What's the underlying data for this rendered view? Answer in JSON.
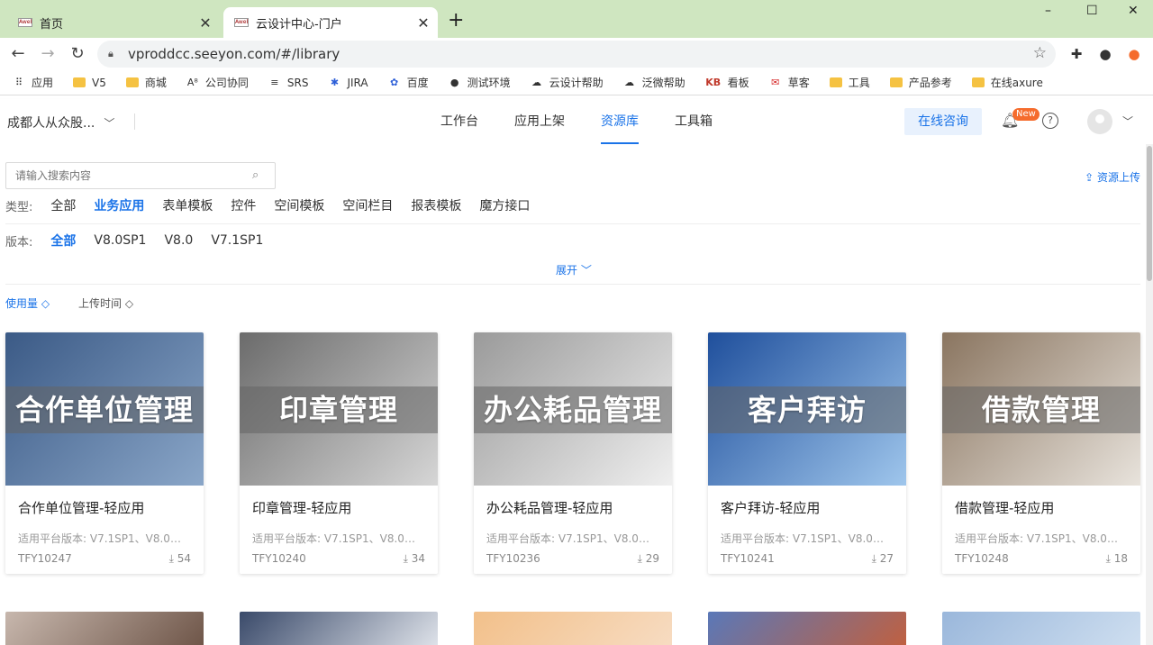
{
  "browser": {
    "tabs": [
      {
        "title": "首页",
        "favicon": "Aweb"
      },
      {
        "title": "云设计中心-门户",
        "favicon": "Aweb"
      }
    ],
    "url": "vproddcc.seeyon.com/#/library",
    "window_controls": {
      "minimize": "–",
      "maximize": "☐",
      "close": "✕"
    },
    "bookmarks": [
      {
        "label": "应用",
        "icon": "apps-grid-icon"
      },
      {
        "label": "V5",
        "icon": "folder-icon"
      },
      {
        "label": "商城",
        "icon": "folder-icon"
      },
      {
        "label": "公司协同",
        "icon": "a8-icon"
      },
      {
        "label": "SRS",
        "icon": "srs-icon"
      },
      {
        "label": "JIRA",
        "icon": "jira-icon"
      },
      {
        "label": "百度",
        "icon": "baidu-icon"
      },
      {
        "label": "测试环境",
        "icon": "globe-icon"
      },
      {
        "label": "云设计帮助",
        "icon": "cloud-icon"
      },
      {
        "label": "泛微帮助",
        "icon": "cloud-icon"
      },
      {
        "label": "看板",
        "icon": "kb-icon"
      },
      {
        "label": "草客",
        "icon": "mail-icon"
      },
      {
        "label": "工具",
        "icon": "folder-icon"
      },
      {
        "label": "产品参考",
        "icon": "folder-icon"
      },
      {
        "label": "在线axure",
        "icon": "folder-icon"
      }
    ]
  },
  "header": {
    "org": "成都人从众股...",
    "nav": [
      "工作台",
      "应用上架",
      "资源库",
      "工具箱"
    ],
    "active_nav": "资源库",
    "consult_label": "在线咨询",
    "new_badge": "New"
  },
  "search": {
    "placeholder": "请输入搜索内容"
  },
  "upload_label": "资源上传",
  "filters": {
    "type_label": "类型:",
    "types": [
      "全部",
      "业务应用",
      "表单模板",
      "控件",
      "空间模板",
      "空间栏目",
      "报表模板",
      "魔方接口"
    ],
    "active_type": "业务应用",
    "version_label": "版本:",
    "versions": [
      "全部",
      "V8.0SP1",
      "V8.0",
      "V7.1SP1"
    ],
    "active_version": "全部",
    "expand_label": "展开"
  },
  "sort": [
    "使用量",
    "上传时间"
  ],
  "cards": [
    {
      "image_title": "合作单位管理",
      "name": "合作单位管理-轻应用",
      "version": "适用平台版本: V7.1SP1、V8.0、...",
      "code": "TFY10247",
      "downloads": "54",
      "colors": [
        "#3b5a86",
        "#8aa6c8"
      ]
    },
    {
      "image_title": "印章管理",
      "name": "印章管理-轻应用",
      "version": "适用平台版本: V7.1SP1、V8.0、...",
      "code": "TFY10240",
      "downloads": "34",
      "colors": [
        "#6b6b6b",
        "#d6d6d6"
      ]
    },
    {
      "image_title": "办公耗品管理",
      "name": "办公耗品管理-轻应用",
      "version": "适用平台版本: V7.1SP1、V8.0、...",
      "code": "TFY10236",
      "downloads": "29",
      "colors": [
        "#9a9a9a",
        "#efefef"
      ]
    },
    {
      "image_title": "客户拜访",
      "name": "客户拜访-轻应用",
      "version": "适用平台版本: V7.1SP1、V8.0、...",
      "code": "TFY10241",
      "downloads": "27",
      "colors": [
        "#1f4f9c",
        "#9fc6ec"
      ]
    },
    {
      "image_title": "借款管理",
      "name": "借款管理-轻应用",
      "version": "适用平台版本: V7.1SP1、V8.0、...",
      "code": "TFY10248",
      "downloads": "18",
      "colors": [
        "#8a7560",
        "#e8e3dc"
      ]
    }
  ],
  "second_row_colors": [
    [
      "#c7b7ad",
      "#6e5548"
    ],
    [
      "#3a4a6a",
      "#dfe3ea"
    ],
    [
      "#f2c08a",
      "#f7dcc2"
    ],
    [
      "#5a78b8",
      "#c06040"
    ],
    [
      "#9ab7db",
      "#cfdff0"
    ]
  ]
}
